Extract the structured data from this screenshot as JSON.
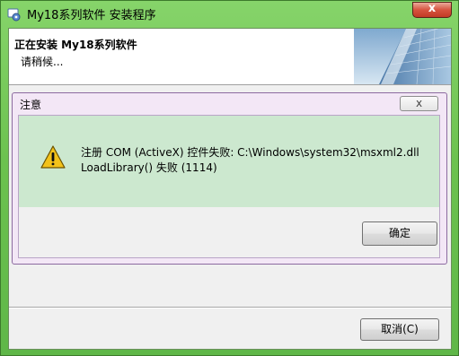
{
  "window": {
    "title": "My18系列软件 安装程序",
    "close_label": "x"
  },
  "header": {
    "title": "正在安装 My18系列软件",
    "subtitle": "请稍候..."
  },
  "footer": {
    "cancel_label": "取消(C)"
  },
  "dialog": {
    "title": "注意",
    "close_label": "x",
    "message_lines": [
      "注册 COM (ActiveX) 控件失败: C:\\Windows\\system32\\msxml2.dll",
      "LoadLibrary() 失败 (1114)"
    ],
    "ok_label": "确定",
    "icon": "warning-icon"
  },
  "colors": {
    "frame": "#6cc24f",
    "dialog_frame": "#f3e7f6",
    "message_panel": "#cce8cf",
    "warning": "#f2c21a"
  }
}
